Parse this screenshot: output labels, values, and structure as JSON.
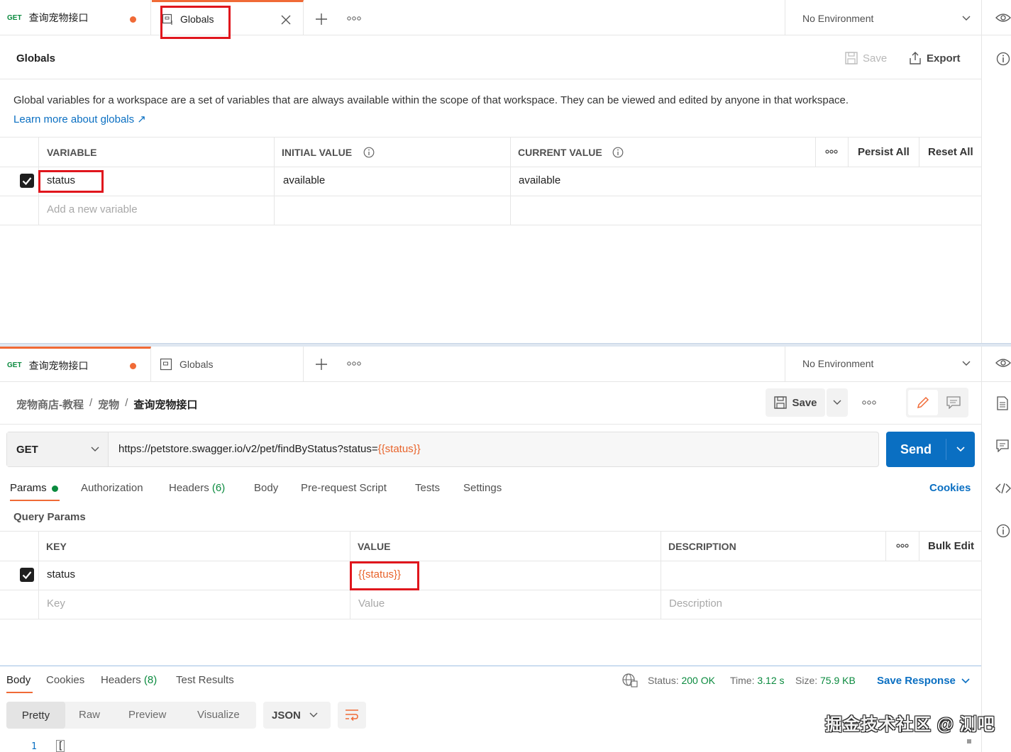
{
  "top": {
    "tabs": [
      {
        "method": "GET",
        "title": "查询宠物接口"
      },
      {
        "title": "Globals"
      }
    ],
    "env": "No Environment",
    "header_title": "Globals",
    "save": "Save",
    "export": "Export",
    "description": "Global variables for a workspace are a set of variables that are always available within the scope of that workspace. They can be viewed and edited by anyone in that workspace.",
    "learn_more": "Learn more about globals ↗",
    "columns": {
      "variable": "VARIABLE",
      "initial": "INITIAL VALUE",
      "current": "CURRENT VALUE"
    },
    "persist_all": "Persist All",
    "reset_all": "Reset All",
    "row": {
      "variable": "status",
      "initial": "available",
      "current": "available"
    },
    "placeholder": "Add a new variable"
  },
  "bottom": {
    "tabs": [
      {
        "method": "GET",
        "title": "查询宠物接口"
      },
      {
        "title": "Globals"
      }
    ],
    "env": "No Environment",
    "breadcrumb": [
      "宠物商店-教程",
      "宠物",
      "查询宠物接口"
    ],
    "save": "Save",
    "method": "GET",
    "url_prefix": "https://petstore.swagger.io/v2/pet/findByStatus?status=",
    "url_var": "{{status}}",
    "send": "Send",
    "req_tabs": [
      "Params",
      "Authorization",
      "Headers",
      "(6)",
      "Body",
      "Pre-request Script",
      "Tests",
      "Settings"
    ],
    "cookies": "Cookies",
    "query_params": "Query Params",
    "qcols": {
      "key": "KEY",
      "value": "VALUE",
      "description": "DESCRIPTION"
    },
    "bulk_edit": "Bulk Edit",
    "qrow": {
      "key": "status",
      "value": "{{status}}"
    },
    "qplaceholder": {
      "key": "Key",
      "value": "Value",
      "description": "Description"
    },
    "resp_tabs": [
      "Body",
      "Cookies",
      "Headers",
      "(8)",
      "Test Results"
    ],
    "status_label": "Status:",
    "status_value": "200 OK",
    "time_label": "Time:",
    "time_value": "3.12 s",
    "size_label": "Size:",
    "size_value": "75.9 KB",
    "save_response": "Save Response",
    "view_tabs": [
      "Pretty",
      "Raw",
      "Preview",
      "Visualize"
    ],
    "format": "JSON",
    "line_no": "1",
    "line_text": "["
  },
  "watermark": "掘金技术社区 @ 测吧",
  "colors": {
    "accent_orange": "#f06a36",
    "send_blue": "#0a6fc2",
    "highlight_red": "#e0161d",
    "status_green": "#0a8a3e"
  }
}
